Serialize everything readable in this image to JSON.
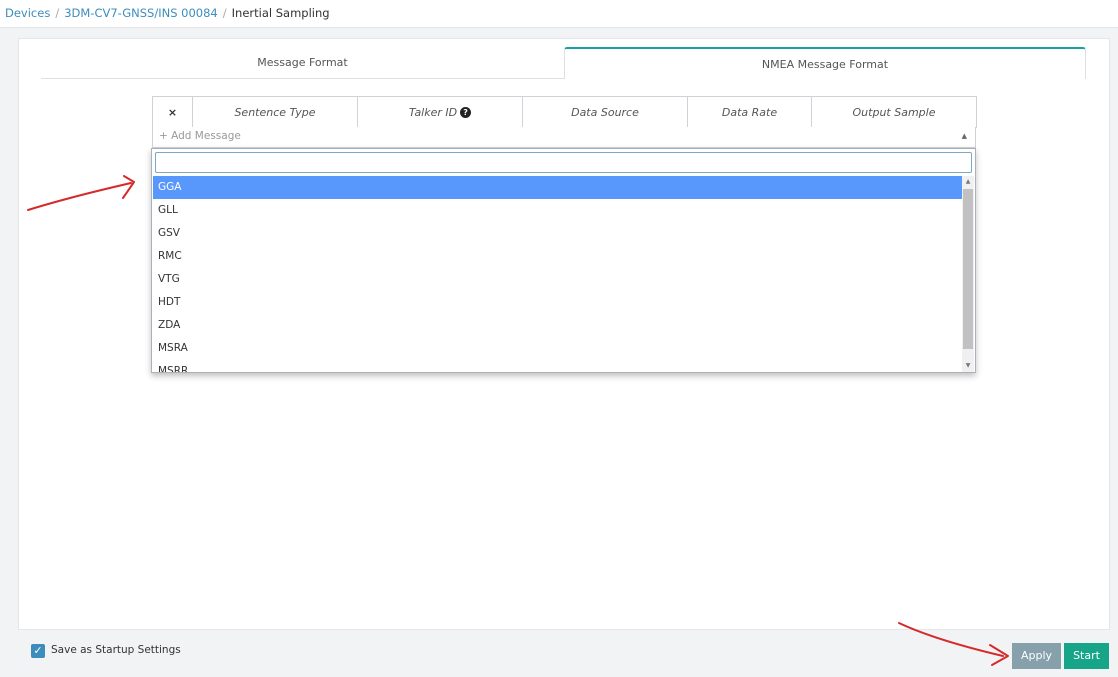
{
  "breadcrumb": {
    "items": [
      "Devices",
      "3DM-CV7-GNSS/INS 00084"
    ],
    "separator": "/",
    "current": "Inertial Sampling"
  },
  "tabs": [
    {
      "label": "Message Format",
      "active": false
    },
    {
      "label": "NMEA Message Format",
      "active": true
    }
  ],
  "table": {
    "delete_icon": "×",
    "headers": [
      "Sentence Type",
      "Talker ID",
      "Data Source",
      "Data Rate",
      "Output Sample"
    ],
    "help_icon": "?"
  },
  "add_message": {
    "placeholder": "+ Add Message",
    "search_value": ""
  },
  "dropdown": {
    "options": [
      "GGA",
      "GLL",
      "GSV",
      "RMC",
      "VTG",
      "HDT",
      "ZDA",
      "MSRA",
      "MSRR"
    ],
    "selected": "GGA"
  },
  "footer": {
    "startup_label": "Save as Startup Settings",
    "startup_checked": true,
    "apply_label": "Apply",
    "start_label": "Start"
  },
  "colors": {
    "accent": "#17a2a2",
    "link": "#3c8dbc",
    "selected_option": "#5897fb",
    "apply_button": "#87a1ac",
    "start_button": "#17a589",
    "annotation_arrow": "#d62a2a"
  }
}
